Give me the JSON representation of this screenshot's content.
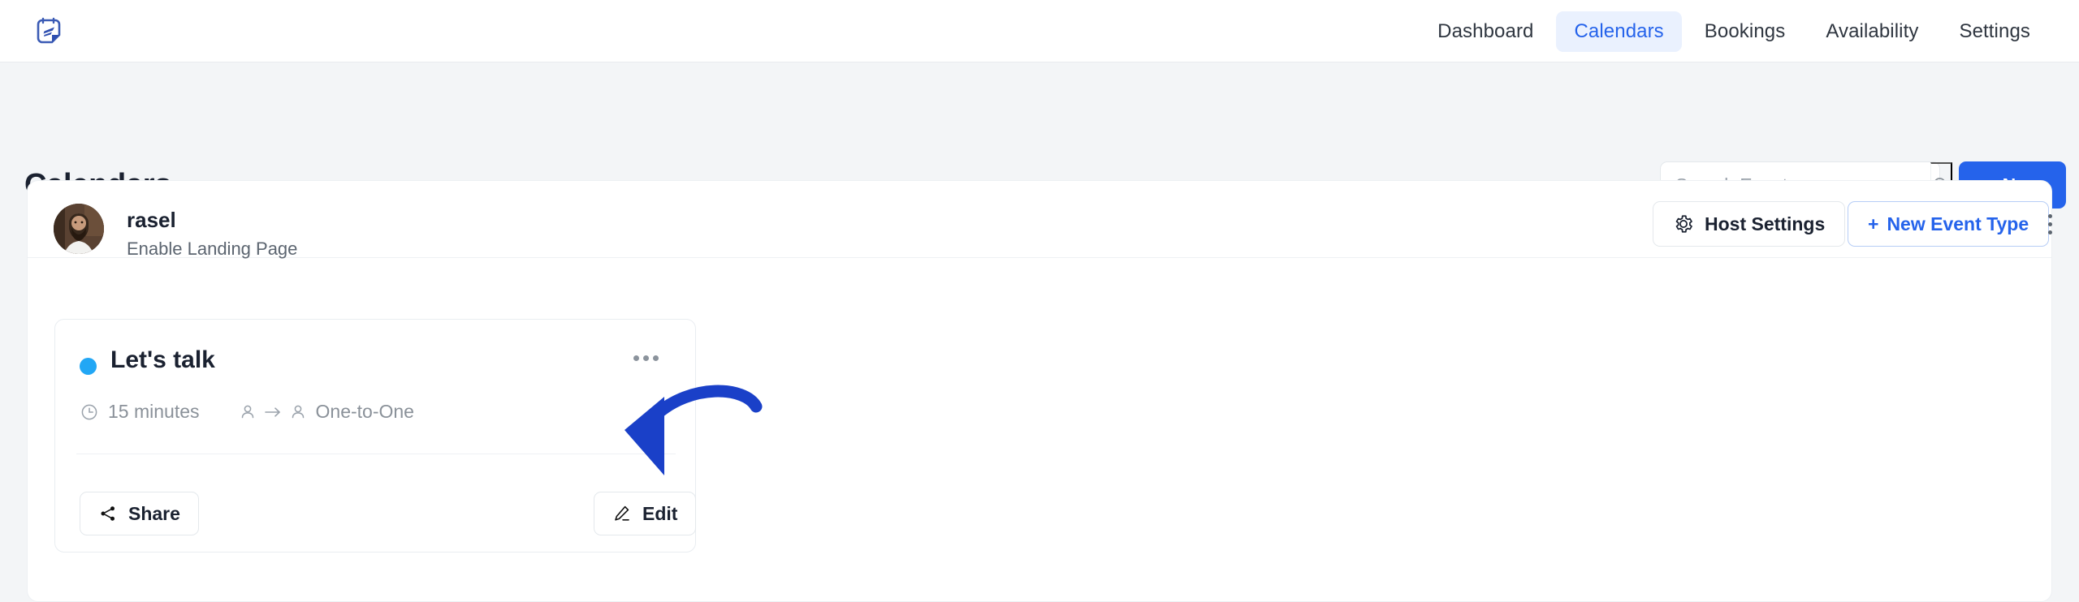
{
  "header": {
    "logo_icon": "calendar-note-icon",
    "nav": [
      {
        "label": "Dashboard",
        "active": false
      },
      {
        "label": "Calendars",
        "active": true
      },
      {
        "label": "Bookings",
        "active": false
      },
      {
        "label": "Availability",
        "active": false
      },
      {
        "label": "Settings",
        "active": false
      }
    ]
  },
  "page": {
    "title": "Calendars",
    "search": {
      "placeholder": "Search Events",
      "value": "",
      "icon": "search-icon"
    },
    "new_button": {
      "label": "New",
      "plus": "+"
    }
  },
  "host": {
    "name": "rasel",
    "subtitle": "Enable Landing Page",
    "avatar_alt": "rasel-avatar",
    "host_settings_label": "Host Settings",
    "host_settings_icon": "gear-icon",
    "new_event_type_label": "New Event Type",
    "new_event_type_plus": "+",
    "more_menu_icon": "vertical-dots-icon"
  },
  "event": {
    "title": "Let's talk",
    "dot_color": "#22a7f5",
    "duration": "15 minutes",
    "duration_icon": "clock-icon",
    "type": "One-to-One",
    "type_icon": "person-to-person-icon",
    "more_icon": "horizontal-dots-icon",
    "share_label": "Share",
    "share_icon": "share-icon",
    "edit_label": "Edit",
    "edit_icon": "pencil-icon"
  },
  "annotation": {
    "arrow_color": "#1a40c8",
    "points_to": "edit-button"
  },
  "colors": {
    "accent": "#2563eb",
    "nav_active_bg": "#eaf1fe",
    "page_bg": "#f3f5f7",
    "text": "#1a2130",
    "muted": "#8a9199"
  }
}
